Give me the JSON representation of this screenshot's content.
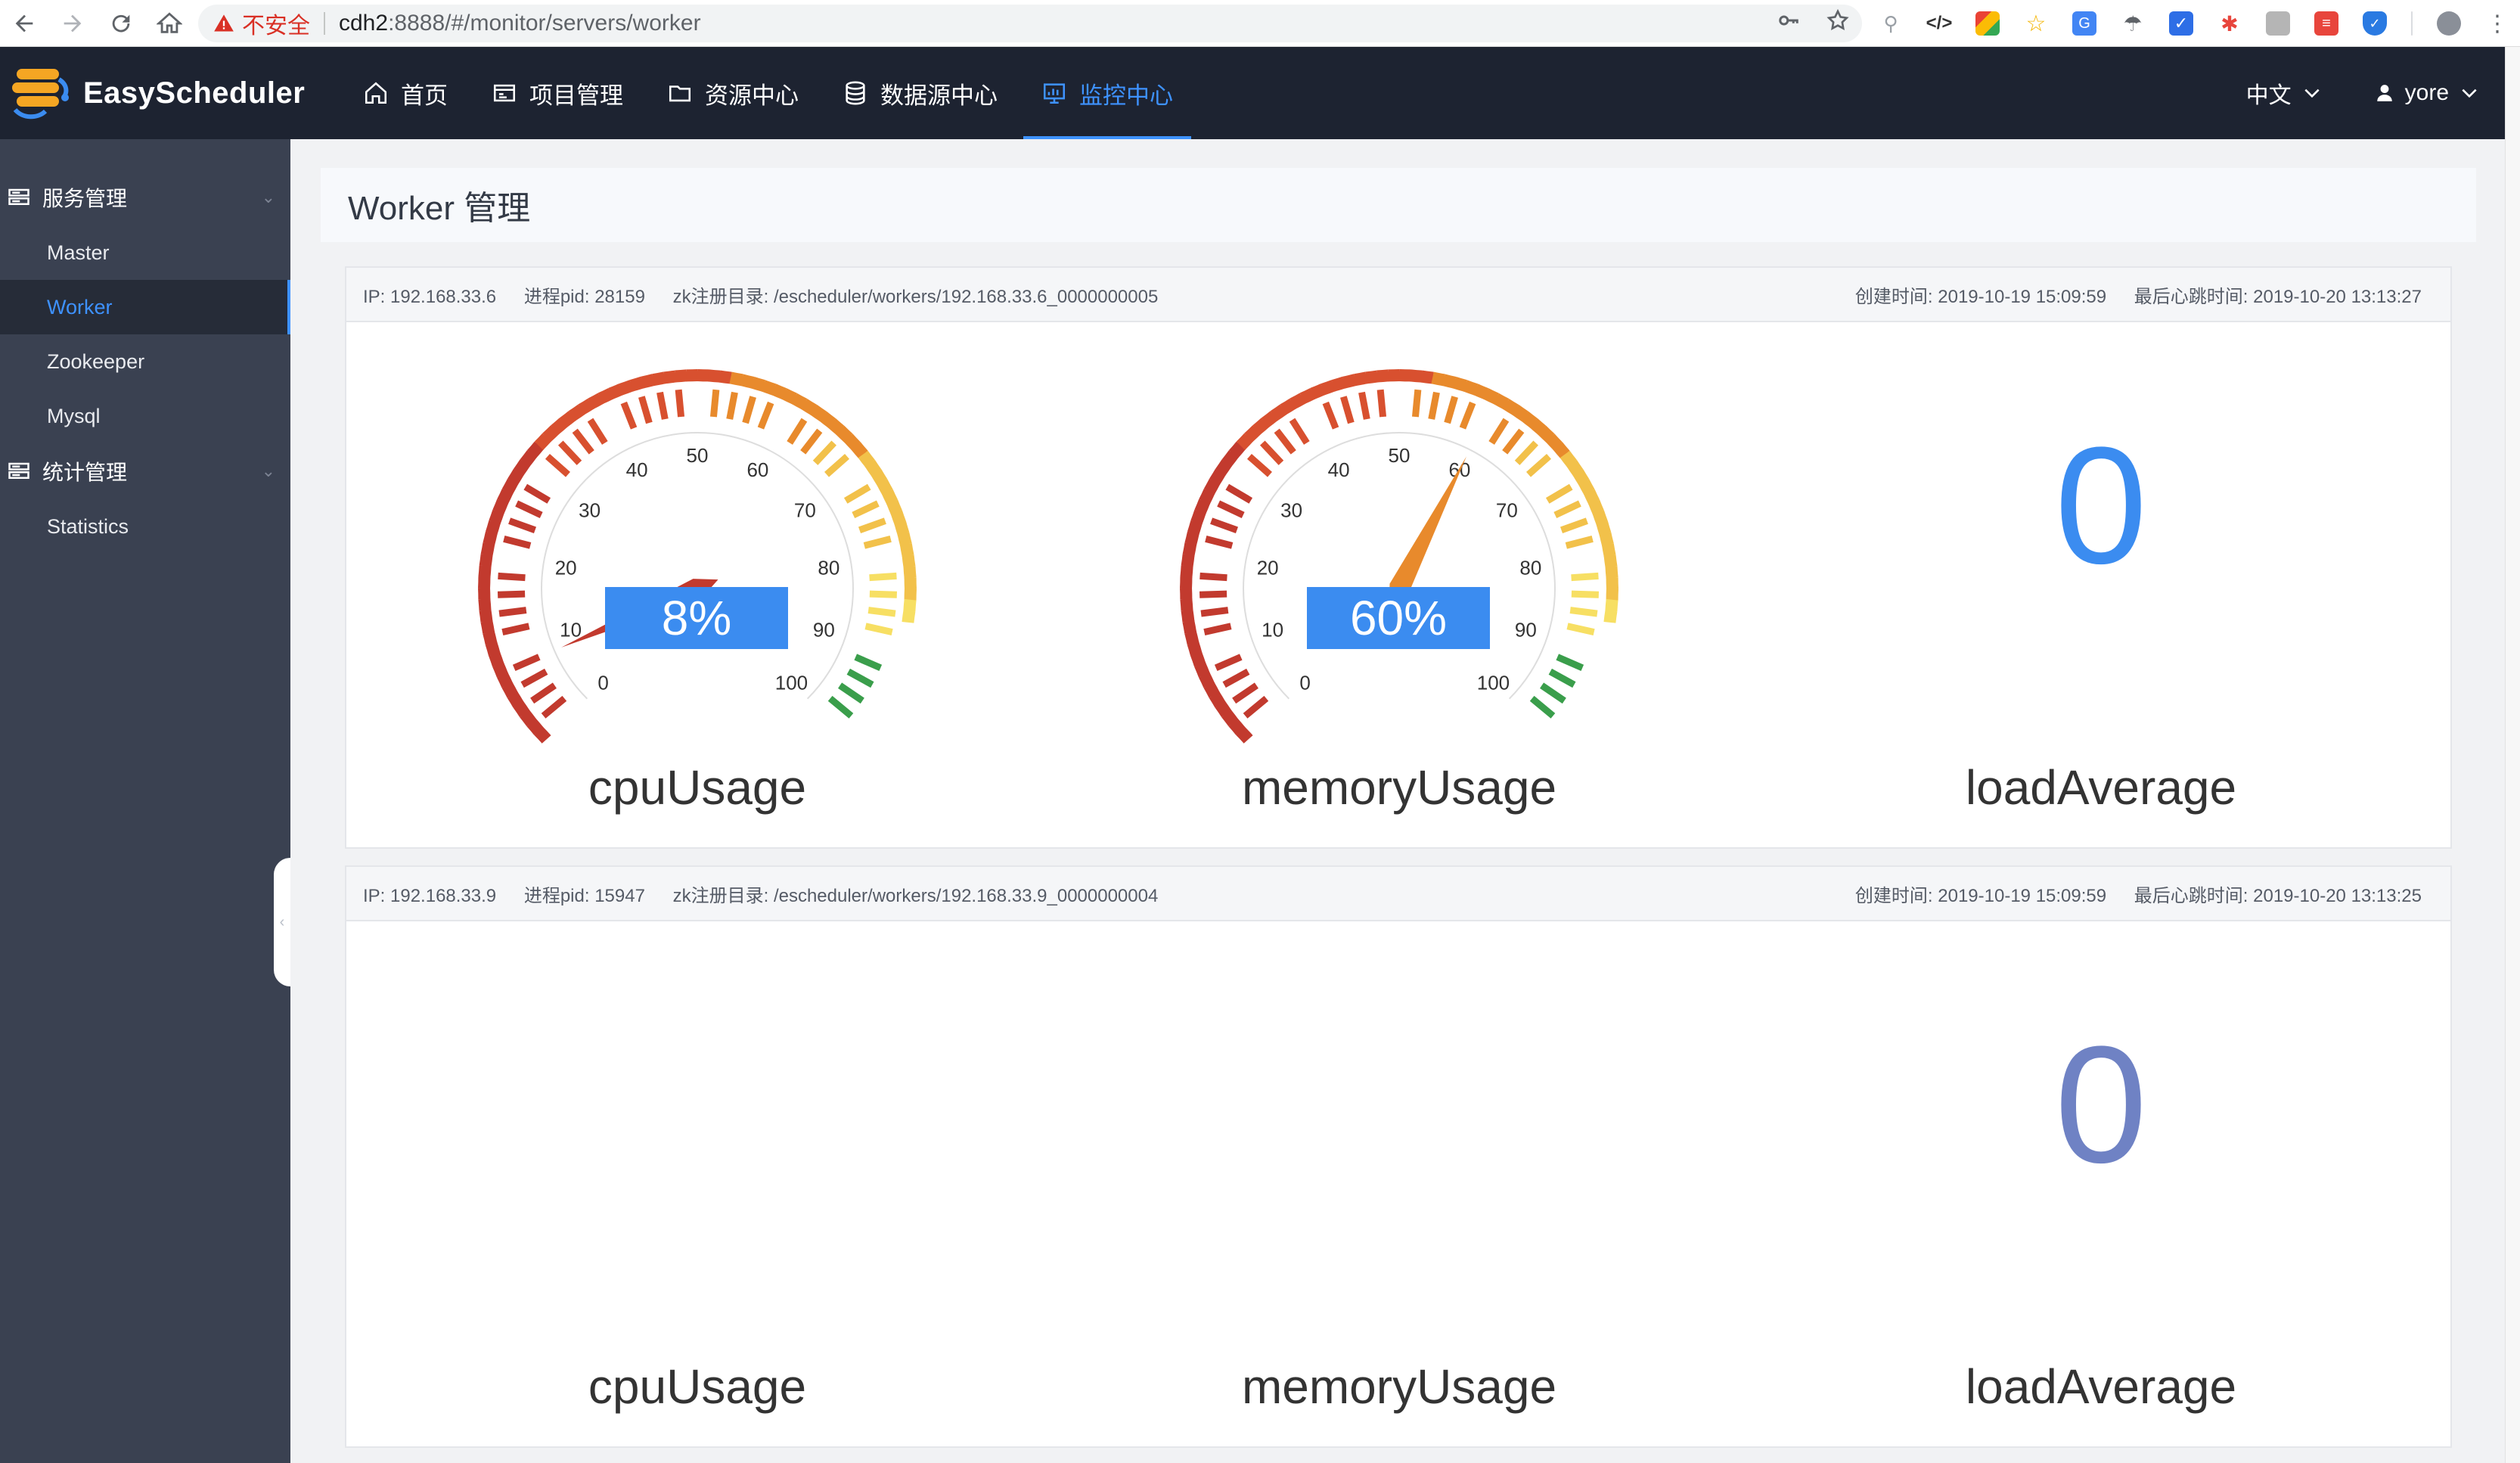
{
  "browser": {
    "insecure_label": "不安全",
    "url_host": "cdh2",
    "url_path": ":8888/#/monitor/servers/worker"
  },
  "app": {
    "name": "EasyScheduler",
    "nav": [
      {
        "label": "首页",
        "icon": "home-icon"
      },
      {
        "label": "项目管理",
        "icon": "project-icon"
      },
      {
        "label": "资源中心",
        "icon": "folder-icon"
      },
      {
        "label": "数据源中心",
        "icon": "database-icon"
      },
      {
        "label": "监控中心",
        "icon": "monitor-icon",
        "active": true
      }
    ],
    "language": "中文",
    "user": "yore",
    "accent_color": "#3e92ff"
  },
  "sidebar": {
    "groups": [
      {
        "label": "服务管理",
        "items": [
          "Master",
          "Worker",
          "Zookeeper",
          "Mysql"
        ],
        "active": "Worker"
      },
      {
        "label": "统计管理",
        "items": [
          "Statistics"
        ]
      }
    ]
  },
  "page": {
    "title": "Worker 管理"
  },
  "workers": [
    {
      "ip": "IP: 192.168.33.6",
      "pid": "进程pid: 28159",
      "zk": "zk注册目录: /escheduler/workers/192.168.33.6_0000000005",
      "created": "创建时间: 2019-10-19 15:09:59",
      "heartbeat": "最后心跳时间: 2019-10-20 13:13:27",
      "cpu": {
        "label": "cpuUsage",
        "value": 8,
        "display": "8%"
      },
      "memory": {
        "label": "memoryUsage",
        "value": 60,
        "display": "60%"
      },
      "load": {
        "label": "loadAverage",
        "value": "0",
        "color": "#3b8cf0"
      },
      "gauges_visible": true
    },
    {
      "ip": "IP: 192.168.33.9",
      "pid": "进程pid: 15947",
      "zk": "zk注册目录: /escheduler/workers/192.168.33.9_0000000004",
      "created": "创建时间: 2019-10-19 15:09:59",
      "heartbeat": "最后心跳时间: 2019-10-20 13:13:25",
      "cpu": {
        "label": "cpuUsage"
      },
      "memory": {
        "label": "memoryUsage"
      },
      "load": {
        "label": "loadAverage",
        "value": "0",
        "color": "#6f82c4"
      },
      "gauges_visible": false
    }
  ],
  "gauge_scale": [
    "0",
    "10",
    "20",
    "30",
    "40",
    "50",
    "60",
    "70",
    "80",
    "90",
    "100"
  ]
}
